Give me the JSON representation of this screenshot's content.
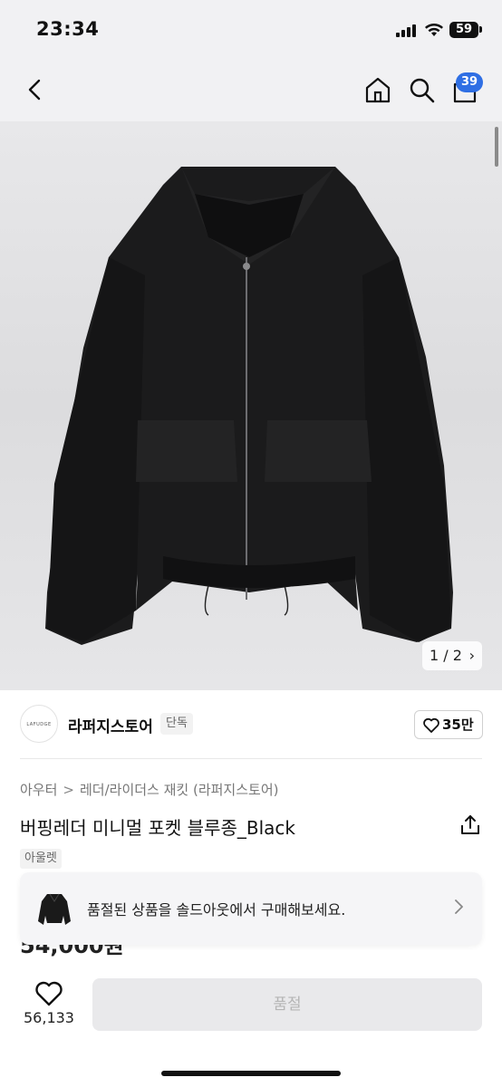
{
  "status_bar": {
    "time": "23:34",
    "battery": "59"
  },
  "header": {
    "cart_count": "39"
  },
  "gallery": {
    "counter": "1 / 2",
    "image_description": "black leather jacket"
  },
  "store": {
    "logo_text": "LAFUDGE",
    "name": "라퍼지스토어",
    "tag": "단독",
    "likes": "35만"
  },
  "product": {
    "breadcrumb": [
      "아우터",
      "레더/라이더스 재킷 (라퍼지스토어)"
    ],
    "title": "버핑레더 미니멀 포켓 블루종_Black",
    "badge": "아울렛",
    "price": "54,000원"
  },
  "banner": {
    "text": "품절된 상품을 솔드아웃에서 구매해보세요."
  },
  "bottom_bar": {
    "wish_count": "56,133",
    "buy_label": "품절"
  },
  "colors": {
    "badge_blue": "#2f6fe4",
    "header_bg": "#f1f1f3",
    "disabled_bg": "#e9e9eb",
    "disabled_text": "#b5b5b5"
  }
}
